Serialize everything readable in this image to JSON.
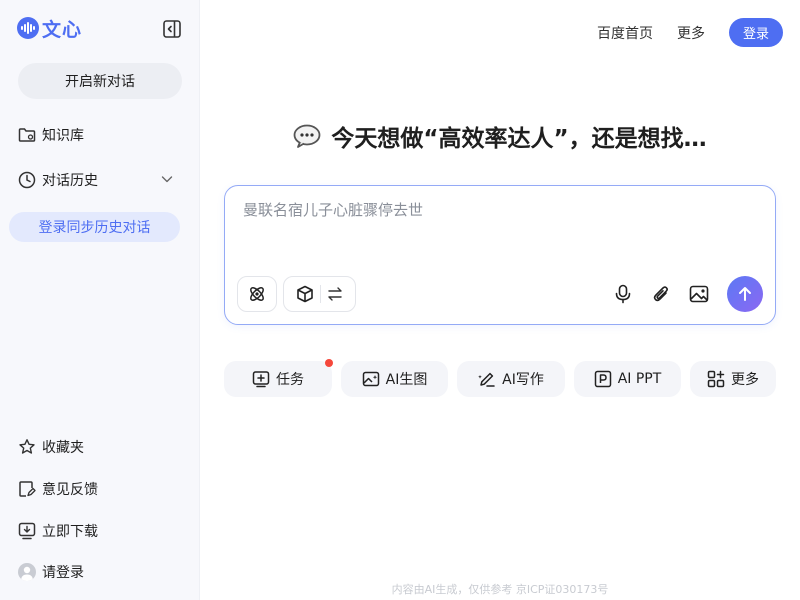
{
  "app": {
    "logo_text": "文心"
  },
  "sidebar": {
    "new_chat_label": "开启新对话",
    "knowledge_label": "知识库",
    "history_label": "对话历史",
    "sync_label": "登录同步历史对话",
    "favorites_label": "收藏夹",
    "feedback_label": "意见反馈",
    "download_label": "立即下载",
    "login_label": "请登录"
  },
  "topnav": {
    "baidu_home": "百度首页",
    "more": "更多",
    "login": "登录"
  },
  "headline": "今天想做“高效率达人”，还是想找…",
  "input": {
    "placeholder": "曼联名宿儿子心脏骤停去世"
  },
  "quick_actions": [
    {
      "label": "任务",
      "icon": "task-icon",
      "has_badge": true
    },
    {
      "label": "AI生图",
      "icon": "image-gen-icon"
    },
    {
      "label": "AI写作",
      "icon": "pen-icon"
    },
    {
      "label": "AI PPT",
      "icon": "ppt-icon"
    },
    {
      "label": "更多",
      "icon": "grid-plus-icon"
    }
  ],
  "footer": "内容由AI生成，仅供参考  京ICP证030173号",
  "colors": {
    "accent": "#4e6ef2",
    "badge": "#f5473b",
    "sidebar_bg": "#f7f8fc"
  }
}
